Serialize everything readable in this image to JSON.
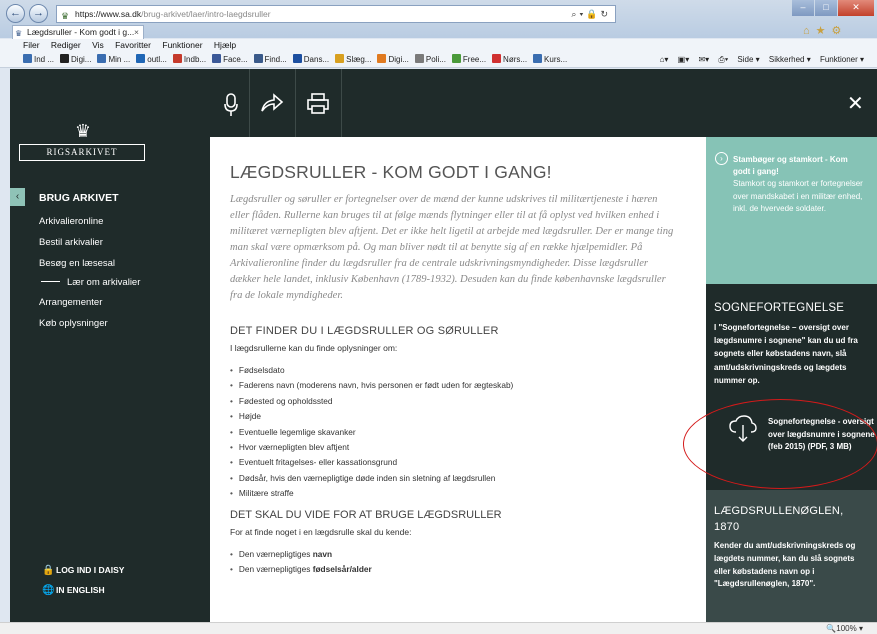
{
  "browser": {
    "url_host": "https://www.sa.dk",
    "url_path": "/brug-arkivet/laer/intro-laegdsruller",
    "tab_title": "Lægdsruller - Kom godt i g...",
    "menu": [
      "Filer",
      "Rediger",
      "Vis",
      "Favoritter",
      "Funktioner",
      "Hjælp"
    ],
    "bookmarks": [
      {
        "label": "Ind ...",
        "color": "#3a6db0"
      },
      {
        "label": "Digi...",
        "color": "#222222"
      },
      {
        "label": "Min ...",
        "color": "#3a6db0"
      },
      {
        "label": "outl...",
        "color": "#1f66b5"
      },
      {
        "label": "Indb...",
        "color": "#c53a2c"
      },
      {
        "label": "Face...",
        "color": "#3b5998"
      },
      {
        "label": "Find...",
        "color": "#3a5a8a"
      },
      {
        "label": "Dans...",
        "color": "#1c4fa0"
      },
      {
        "label": "Slæg...",
        "color": "#d8a020"
      },
      {
        "label": "Digi...",
        "color": "#e07a20"
      },
      {
        "label": "Poli...",
        "color": "#7a7a7a"
      },
      {
        "label": "Free...",
        "color": "#4a9a3a"
      },
      {
        "label": "Nørs...",
        "color": "#d03030"
      },
      {
        "label": "Kurs...",
        "color": "#3a6db0"
      }
    ],
    "commands": [
      "Side ▾",
      "Sikkerhed ▾",
      "Funktioner ▾"
    ],
    "zoom": "100%"
  },
  "sidebar": {
    "logo_text": "RIGSARKIVET",
    "heading": "BRUG ARKIVET",
    "items": [
      "Arkivalieronline",
      "Bestil arkivalier",
      "Besøg en læsesal"
    ],
    "sub_item": "Lær om arkivalier",
    "items2": [
      "Arrangementer",
      "Køb oplysninger"
    ],
    "login": "LOG IND I DAISY",
    "english": "IN ENGLISH"
  },
  "main": {
    "title": "LÆGDSRULLER - KOM GODT I GANG!",
    "intro": "Lægdsruller og søruller er fortegnelser over de mænd der kunne udskrives til militærtjeneste i hæren eller flåden. Rullerne kan bruges til at følge mænds flytninger eller til at få oplyst ved hvilken enhed i militæret værnepligten blev aftjent. Det er ikke helt ligetil at arbejde med lægdsruller. Der er mange ting man skal være opmærksom på. Og man bliver nødt til at benytte sig af en række hjælpemidler. På Arkivalieronline finder du lægdsruller fra de centrale udskrivningsmyndigheder. Disse lægdsruller dækker hele landet, inklusiv København (1789-1932). Desuden kan du finde københavnske lægdsruller fra de lokale myndigheder.",
    "section1_title": "DET FINDER DU I LÆGDSRULLER OG SØRULLER",
    "section1_text": "I lægdsrullerne kan du finde oplysninger om:",
    "section1_items": [
      "Fødselsdato",
      "Faderens navn (moderens navn, hvis personen er født uden for ægteskab)",
      "Fødested og opholdssted",
      "Højde",
      "Eventuelle legemlige skavanker",
      "Hvor værnepligten blev aftjent",
      "Eventuelt fritagelses- eller kassationsgrund",
      "Dødsår, hvis den værnepligtige døde inden sin sletning af lægdsrullen",
      "Militære straffe"
    ],
    "section2_title": "DET SKAL DU VIDE FOR AT BRUGE LÆGDSRULLER",
    "section2_text": "For at finde noget i en lægdsrulle skal du kende:",
    "section2_items": [
      {
        "prefix": "Den værnepligtiges ",
        "bold": "navn"
      },
      {
        "prefix": "Den værnepligtiges ",
        "bold": "fødselsår/alder"
      }
    ]
  },
  "right": {
    "teal_title": "Stambøger og stamkort - Kom godt i gang!",
    "teal_text": "Stamkort og stamkort er fortegnelser over mandskabet i en militær enhed, inkl. de hvervede soldater.",
    "box2_title": "SOGNEFORTEGNELSE",
    "box2_text": "I \"Sognefortegnelse – oversigt over lægdsnumre i sognene\" kan du ud fra sognets eller købstadens navn, slå amt/udskrivningskreds og lægdets nummer op.",
    "download_text": "Sognefortegnelse - oversigt over lægdsnumre i sognene (feb 2015) (PDF, 3 MB)",
    "box3_title": "LÆGDSRULLENØGLEN, 1870",
    "box3_text": "Kender du amt/udskrivningskreds og lægdets nummer, kan du slå sognets eller købstadens navn op i \"Lægdsrullenøglen, 1870\"."
  },
  "colors": {
    "teal": "#86c3b6",
    "dark": "#1f2b2a",
    "highlight": "#d41a1a"
  }
}
